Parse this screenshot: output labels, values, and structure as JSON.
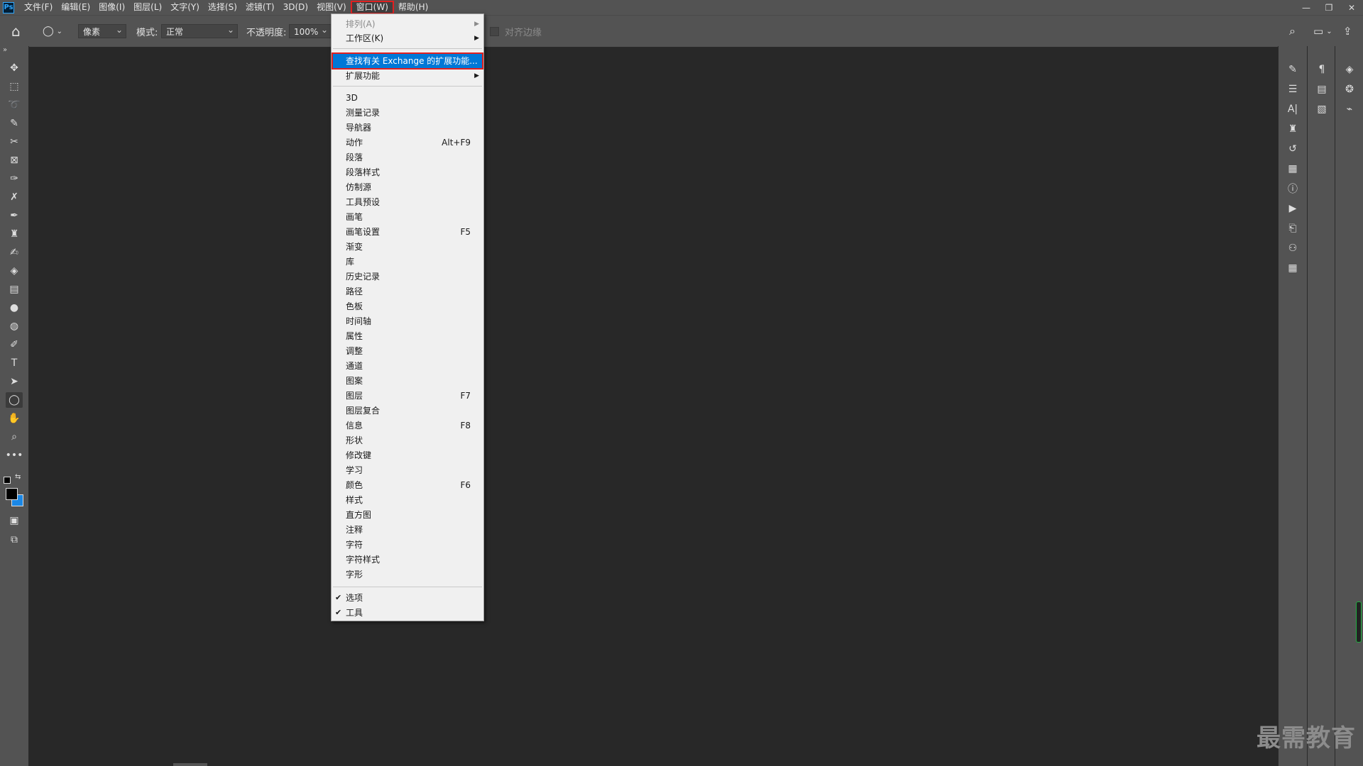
{
  "menubar": {
    "logo": "Ps",
    "items": [
      {
        "label": "文件(F)"
      },
      {
        "label": "编辑(E)"
      },
      {
        "label": "图像(I)"
      },
      {
        "label": "图层(L)"
      },
      {
        "label": "文字(Y)"
      },
      {
        "label": "选择(S)"
      },
      {
        "label": "滤镜(T)"
      },
      {
        "label": "3D(D)"
      },
      {
        "label": "视图(V)"
      },
      {
        "label": "窗口(W)",
        "active": true
      },
      {
        "label": "帮助(H)"
      }
    ],
    "window_controls": {
      "minimize": "—",
      "restore": "❐",
      "close": "✕"
    }
  },
  "options": {
    "home_icon": "⌂",
    "shape_icon": "◯",
    "unit_label": "像素",
    "mode_label": "模式:",
    "mode_value": "正常",
    "opacity_label": "不透明度:",
    "opacity_value": "100%",
    "align_label": "对齐边缘"
  },
  "tools": [
    {
      "name": "move-tool-icon",
      "glyph": "✥"
    },
    {
      "name": "marquee-tool-icon",
      "glyph": "⬚"
    },
    {
      "name": "lasso-tool-icon",
      "glyph": "➰"
    },
    {
      "name": "quick-select-tool-icon",
      "glyph": "✎"
    },
    {
      "name": "crop-tool-icon",
      "glyph": "✂"
    },
    {
      "name": "frame-tool-icon",
      "glyph": "⊠"
    },
    {
      "name": "eyedropper-tool-icon",
      "glyph": "✑"
    },
    {
      "name": "healing-tool-icon",
      "glyph": "✗"
    },
    {
      "name": "brush-tool-icon",
      "glyph": "✒"
    },
    {
      "name": "stamp-tool-icon",
      "glyph": "♜"
    },
    {
      "name": "history-brush-tool-icon",
      "glyph": "✍"
    },
    {
      "name": "eraser-tool-icon",
      "glyph": "◈"
    },
    {
      "name": "gradient-tool-icon",
      "glyph": "▤"
    },
    {
      "name": "blur-tool-icon",
      "glyph": "●"
    },
    {
      "name": "dodge-tool-icon",
      "glyph": "◍"
    },
    {
      "name": "pen-tool-icon",
      "glyph": "✐"
    },
    {
      "name": "type-tool-icon",
      "glyph": "T"
    },
    {
      "name": "path-select-tool-icon",
      "glyph": "➤"
    },
    {
      "name": "ellipse-tool-icon",
      "glyph": "◯",
      "active": true
    },
    {
      "name": "hand-tool-icon",
      "glyph": "✋"
    },
    {
      "name": "zoom-tool-icon",
      "glyph": "⌕"
    },
    {
      "name": "more-tools-icon",
      "glyph": "•••"
    }
  ],
  "toolbar_extra": {
    "swap_icon": "⇆",
    "quickmask_icon": "▣",
    "screenmode_icon": "⧉",
    "collapse_icon": "»"
  },
  "dock1_icons": [
    {
      "name": "brush-settings-panel-icon",
      "glyph": "✎"
    },
    {
      "name": "adjust-panel-icon",
      "glyph": "☰"
    },
    {
      "name": "character-panel-icon",
      "glyph": "A|"
    },
    {
      "name": "clone-source-panel-icon",
      "glyph": "♜"
    },
    {
      "name": "history-panel-icon",
      "glyph": "↺"
    },
    {
      "name": "properties-panel-icon",
      "glyph": "▦"
    },
    {
      "name": "info-panel-icon",
      "glyph": "ⓘ"
    },
    {
      "name": "actions-panel-icon",
      "glyph": "▶"
    },
    {
      "name": "measurement-panel-icon",
      "glyph": "⎗"
    },
    {
      "name": "3d-panel-icon",
      "glyph": "⚇"
    },
    {
      "name": "timeline-panel-icon",
      "glyph": "▦"
    }
  ],
  "dock2_icons": [
    {
      "name": "paragraph-panel-icon",
      "glyph": "¶"
    },
    {
      "name": "glyphs-panel-icon",
      "glyph": "▤"
    },
    {
      "name": "notes-panel-icon",
      "glyph": "▧"
    }
  ],
  "dock3_icons": [
    {
      "name": "layers-panel-icon",
      "glyph": "◈"
    },
    {
      "name": "channels-panel-icon",
      "glyph": "❂"
    },
    {
      "name": "paths-panel-icon",
      "glyph": "⌁"
    }
  ],
  "top_right": {
    "search_icon": "⌕",
    "workspace_icon": "▭",
    "share_icon": "⇪"
  },
  "window_menu": {
    "arrange": "排列(A)",
    "workspace": "工作区(K)",
    "find_exchange": "查找有关 Exchange 的扩展功能...",
    "extensions": "扩展功能",
    "panels": [
      {
        "label": "3D",
        "shortcut": ""
      },
      {
        "label": "测量记录",
        "shortcut": ""
      },
      {
        "label": "导航器",
        "shortcut": ""
      },
      {
        "label": "动作",
        "shortcut": "Alt+F9"
      },
      {
        "label": "段落",
        "shortcut": ""
      },
      {
        "label": "段落样式",
        "shortcut": ""
      },
      {
        "label": "仿制源",
        "shortcut": ""
      },
      {
        "label": "工具预设",
        "shortcut": ""
      },
      {
        "label": "画笔",
        "shortcut": ""
      },
      {
        "label": "画笔设置",
        "shortcut": "F5"
      },
      {
        "label": "渐变",
        "shortcut": ""
      },
      {
        "label": "库",
        "shortcut": ""
      },
      {
        "label": "历史记录",
        "shortcut": ""
      },
      {
        "label": "路径",
        "shortcut": ""
      },
      {
        "label": "色板",
        "shortcut": ""
      },
      {
        "label": "时间轴",
        "shortcut": ""
      },
      {
        "label": "属性",
        "shortcut": ""
      },
      {
        "label": "调整",
        "shortcut": ""
      },
      {
        "label": "通道",
        "shortcut": ""
      },
      {
        "label": "图案",
        "shortcut": ""
      },
      {
        "label": "图层",
        "shortcut": "F7"
      },
      {
        "label": "图层复合",
        "shortcut": ""
      },
      {
        "label": "信息",
        "shortcut": "F8"
      },
      {
        "label": "形状",
        "shortcut": ""
      },
      {
        "label": "修改键",
        "shortcut": ""
      },
      {
        "label": "学习",
        "shortcut": ""
      },
      {
        "label": "颜色",
        "shortcut": "F6"
      },
      {
        "label": "样式",
        "shortcut": ""
      },
      {
        "label": "直方图",
        "shortcut": ""
      },
      {
        "label": "注释",
        "shortcut": ""
      },
      {
        "label": "字符",
        "shortcut": ""
      },
      {
        "label": "字符样式",
        "shortcut": ""
      },
      {
        "label": "字形",
        "shortcut": ""
      }
    ],
    "options_item": "选项",
    "tools_item": "工具",
    "check_glyph": "✔",
    "arrow_glyph": "▶"
  },
  "watermark": "最需教育",
  "colors": {
    "accent": "#0078d7",
    "highlight_border": "#e02020",
    "foreground": "#000000",
    "background": "#1a87e6"
  }
}
